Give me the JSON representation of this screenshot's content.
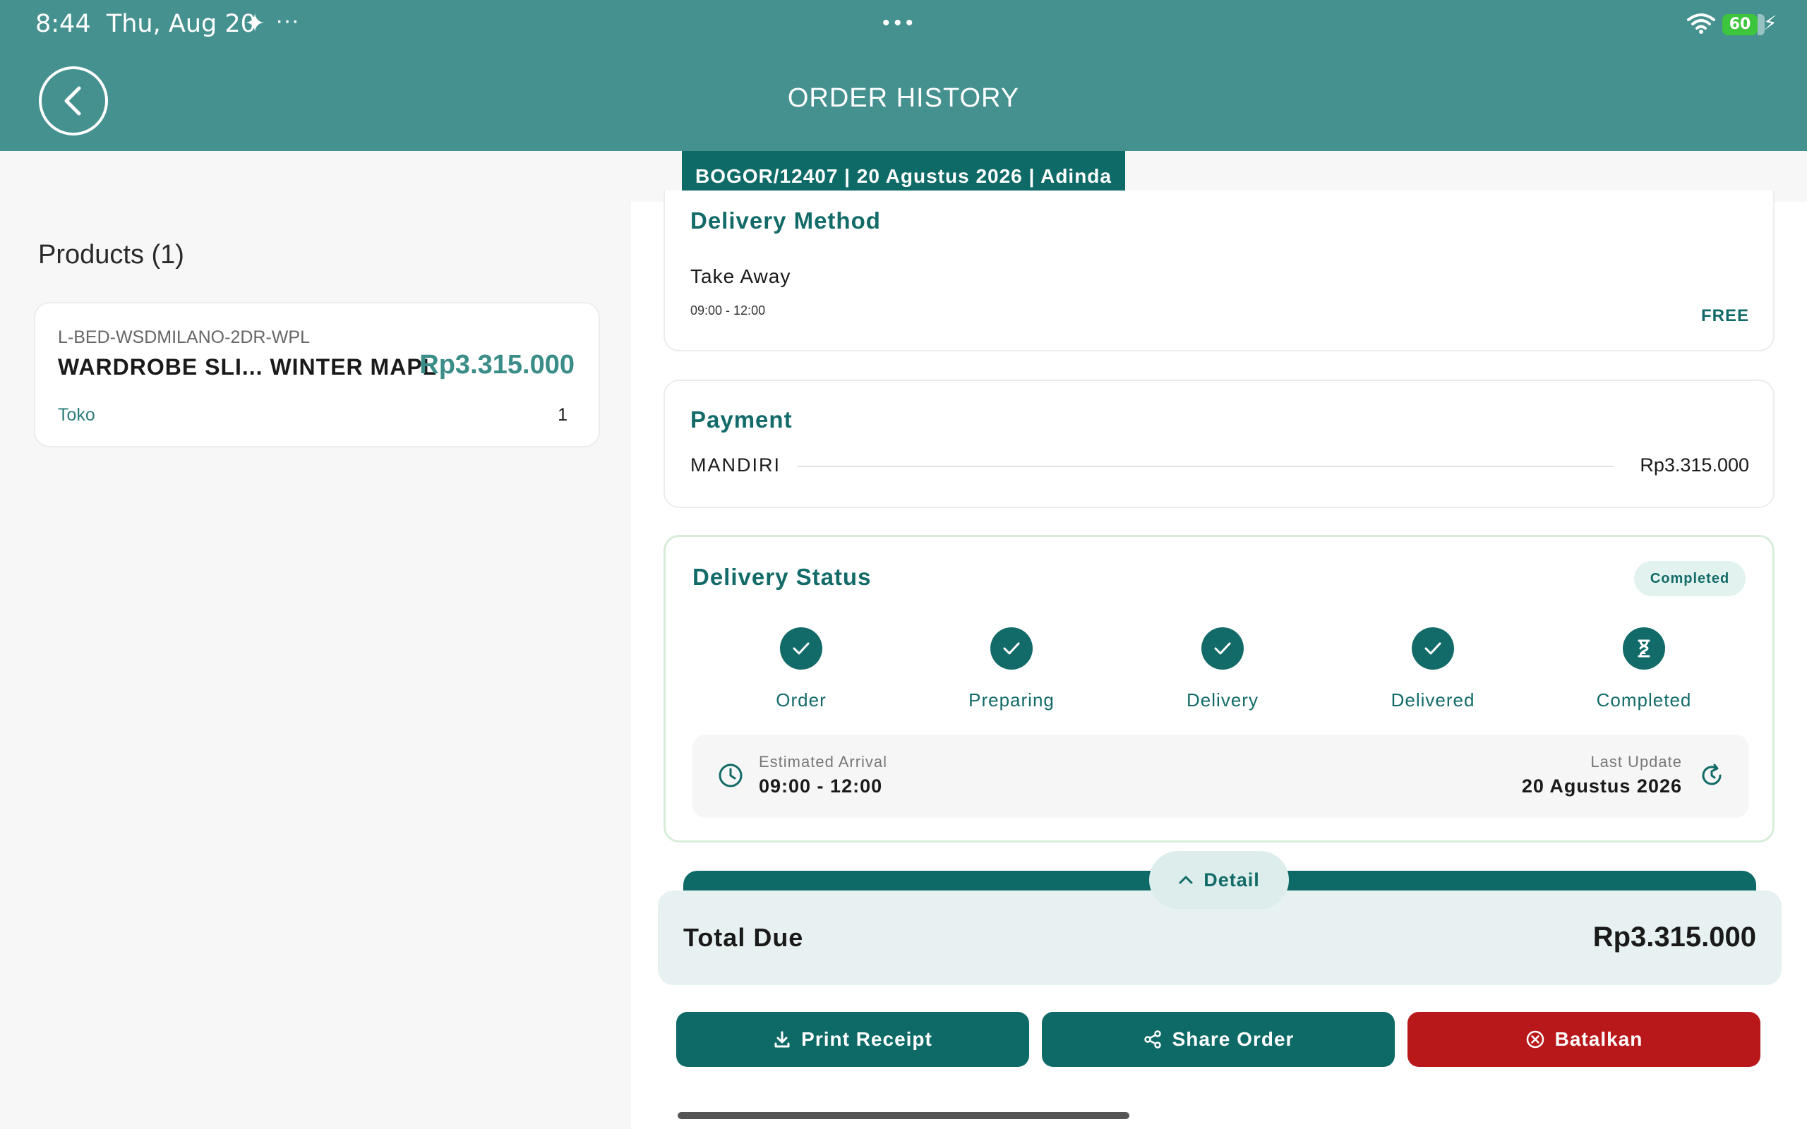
{
  "status_bar": {
    "time": "8:44",
    "date": "Thu, Aug 20",
    "battery": "60"
  },
  "header": {
    "title": "ORDER HISTORY"
  },
  "order_tab": {
    "label": "BOGOR/12407 | 20 Agustus 2026 | Adinda"
  },
  "products": {
    "title": "Products (1)",
    "items": [
      {
        "sku": "L-BED-WSDMILANO-2DR-WPL",
        "name": "WARDROBE SLI... WINTER MAPL",
        "price": "Rp3.315.000",
        "store": "Toko",
        "qty": "1"
      }
    ]
  },
  "delivery_method": {
    "title": "Delivery Method",
    "method": "Take Away",
    "time": "09:00 - 12:00",
    "fee": "FREE"
  },
  "payment": {
    "title": "Payment",
    "method": "MANDIRI",
    "amount": "Rp3.315.000"
  },
  "delivery_status": {
    "title": "Delivery Status",
    "badge": "Completed",
    "steps": [
      {
        "label": "Order",
        "icon": "check-icon"
      },
      {
        "label": "Preparing",
        "icon": "check-icon"
      },
      {
        "label": "Delivery",
        "icon": "check-icon"
      },
      {
        "label": "Delivered",
        "icon": "check-icon"
      },
      {
        "label": "Completed",
        "icon": "hourglass-icon"
      }
    ],
    "eta_label": "Estimated Arrival",
    "eta_value": "09:00 - 12:00",
    "last_update_label": "Last Update",
    "last_update_value": "20 Agustus 2026"
  },
  "total": {
    "detail_label": "Detail",
    "label": "Total Due",
    "amount": "Rp3.315.000"
  },
  "actions": {
    "print": "Print Receipt",
    "share": "Share Order",
    "cancel": "Batalkan"
  },
  "colors": {
    "header": "#44918f",
    "primary": "#0e6a67",
    "danger": "#b9181b",
    "accent_price": "#3a8d88"
  }
}
